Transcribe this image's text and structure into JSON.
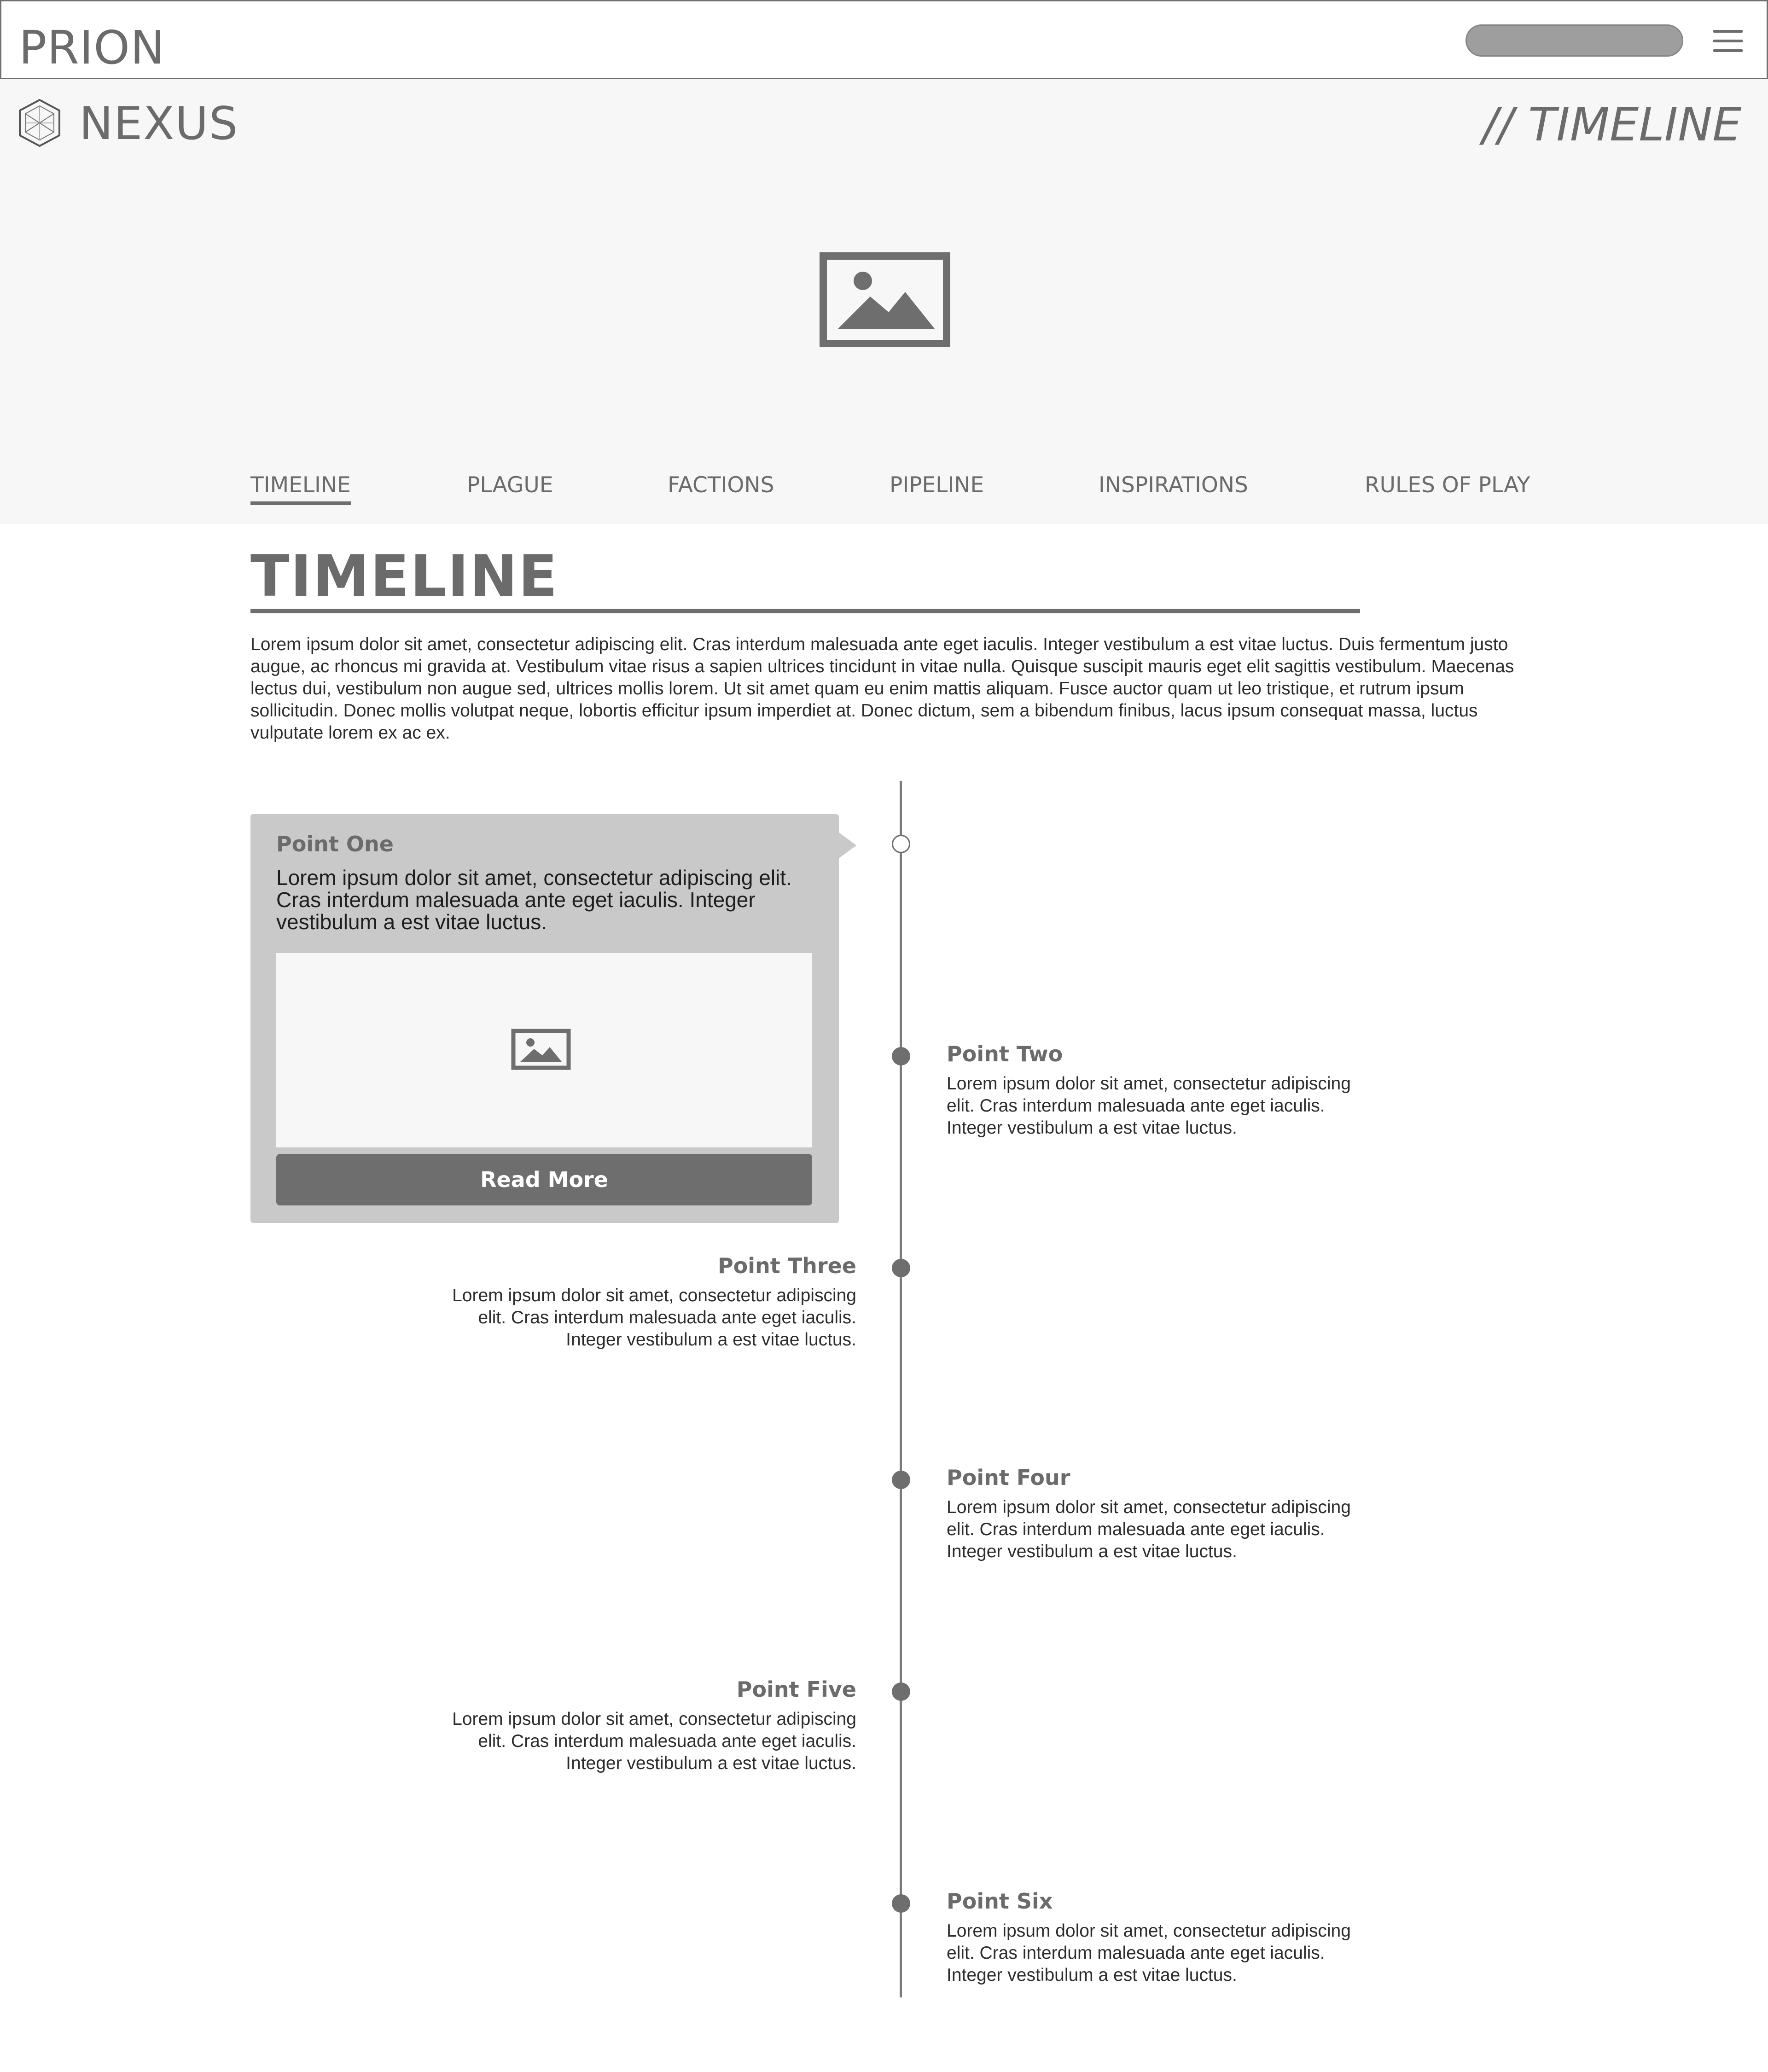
{
  "topbar": {
    "brand": "PRION",
    "menu_icon": "hamburger-menu-icon"
  },
  "hero": {
    "logo_icon": "hexagon-logo-icon",
    "logo_text": "NEXUS",
    "page_label": "// TIMELINE",
    "image_icon": "image-placeholder-icon"
  },
  "nav": {
    "tabs": [
      {
        "label": "TIMELINE",
        "active": true
      },
      {
        "label": "PLAGUE"
      },
      {
        "label": "FACTIONS"
      },
      {
        "label": "PIPELINE"
      },
      {
        "label": "INSPIRATIONS"
      },
      {
        "label": "RULES OF PLAY"
      }
    ]
  },
  "section": {
    "title": "TIMELINE",
    "intro": "Lorem ipsum dolor sit amet, consectetur adipiscing elit. Cras interdum malesuada ante eget iaculis. Integer vestibulum a est vitae luctus. Duis fermentum justo augue, ac rhoncus mi gravida at. Vestibulum vitae risus a sapien ultrices tincidunt in vitae nulla. Quisque suscipit mauris eget elit sagittis vestibulum. Maecenas lectus dui, vestibulum non augue sed, ultrices mollis lorem. Ut sit amet quam eu enim mattis aliquam. Fusce auctor quam ut leo tristique, et rutrum ipsum sollicitudin. Donec mollis volutpat neque, lobortis efficitur ipsum imperdiet at. Donec dictum, sem a bibendum finibus, lacus ipsum consequat massa, luctus vulputate lorem ex ac ex."
  },
  "timeline": {
    "featured": {
      "title": "Point One",
      "text": "Lorem ipsum dolor sit amet, consectetur adipiscing elit. Cras interdum malesuada ante eget iaculis. Integer vestibulum a est vitae luctus.",
      "image_icon": "image-placeholder-icon",
      "button": "Read More"
    },
    "points": [
      {
        "title": "Point Two",
        "text": "Lorem ipsum dolor sit amet, consectetur adipiscing elit. Cras interdum malesuada ante eget iaculis. Integer vestibulum a est vitae luctus."
      },
      {
        "title": "Point Three",
        "text": "Lorem ipsum dolor sit amet, consectetur adipiscing elit. Cras interdum malesuada ante eget iaculis. Integer vestibulum a est vitae luctus."
      },
      {
        "title": "Point Four",
        "text": "Lorem ipsum dolor sit amet, consectetur adipiscing elit. Cras interdum malesuada ante eget iaculis. Integer vestibulum a est vitae luctus."
      },
      {
        "title": "Point Five",
        "text": "Lorem ipsum dolor sit amet, consectetur adipiscing elit. Cras interdum malesuada ante eget iaculis. Integer vestibulum a est vitae luctus."
      },
      {
        "title": "Point Six",
        "text": "Lorem ipsum dolor sit amet, consectetur adipiscing elit. Cras interdum malesuada ante eget iaculis. Integer vestibulum a est vitae luctus."
      }
    ]
  },
  "colors": {
    "accent": "#6e6e6e",
    "hero_bg": "#f7f7f7",
    "card_bg": "#c9c9c9"
  }
}
